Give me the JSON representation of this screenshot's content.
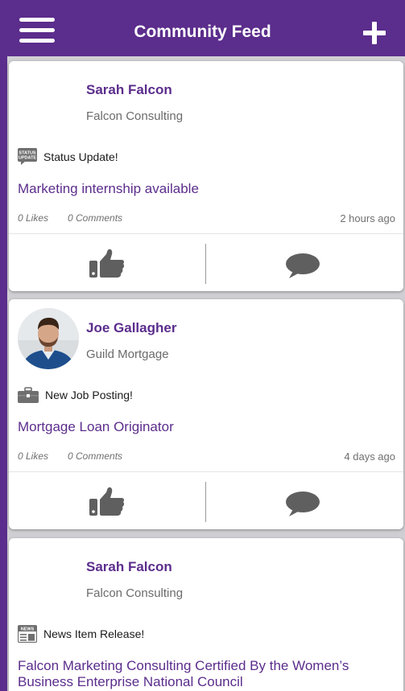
{
  "header": {
    "title": "Community Feed",
    "menu_icon": "hamburger-menu-icon",
    "add_icon": "plus-icon"
  },
  "colors": {
    "brand": "#5b2d8c",
    "feed_background": "#cfcfd3",
    "meta_text": "#707070"
  },
  "posts": [
    {
      "author": "Sarah Falcon",
      "company": "Falcon Consulting",
      "type_label": "Status Update!",
      "type_icon": "status-update-icon",
      "title": "Marketing internship available",
      "likes": "0 Likes",
      "comments": "0 Comments",
      "time": "2 hours ago"
    },
    {
      "author": "Joe Gallagher",
      "company": "Guild Mortgage",
      "type_label": "New Job Posting!",
      "type_icon": "briefcase-icon",
      "title": "Mortgage Loan Originator",
      "likes": "0 Likes",
      "comments": "0 Comments",
      "time": "4 days ago"
    },
    {
      "author": "Sarah Falcon",
      "company": "Falcon Consulting",
      "type_label": "News Item Release!",
      "type_icon": "news-icon",
      "title": "Falcon Marketing Consulting Certified By the Women’s Business Enterprise National Council"
    }
  ]
}
